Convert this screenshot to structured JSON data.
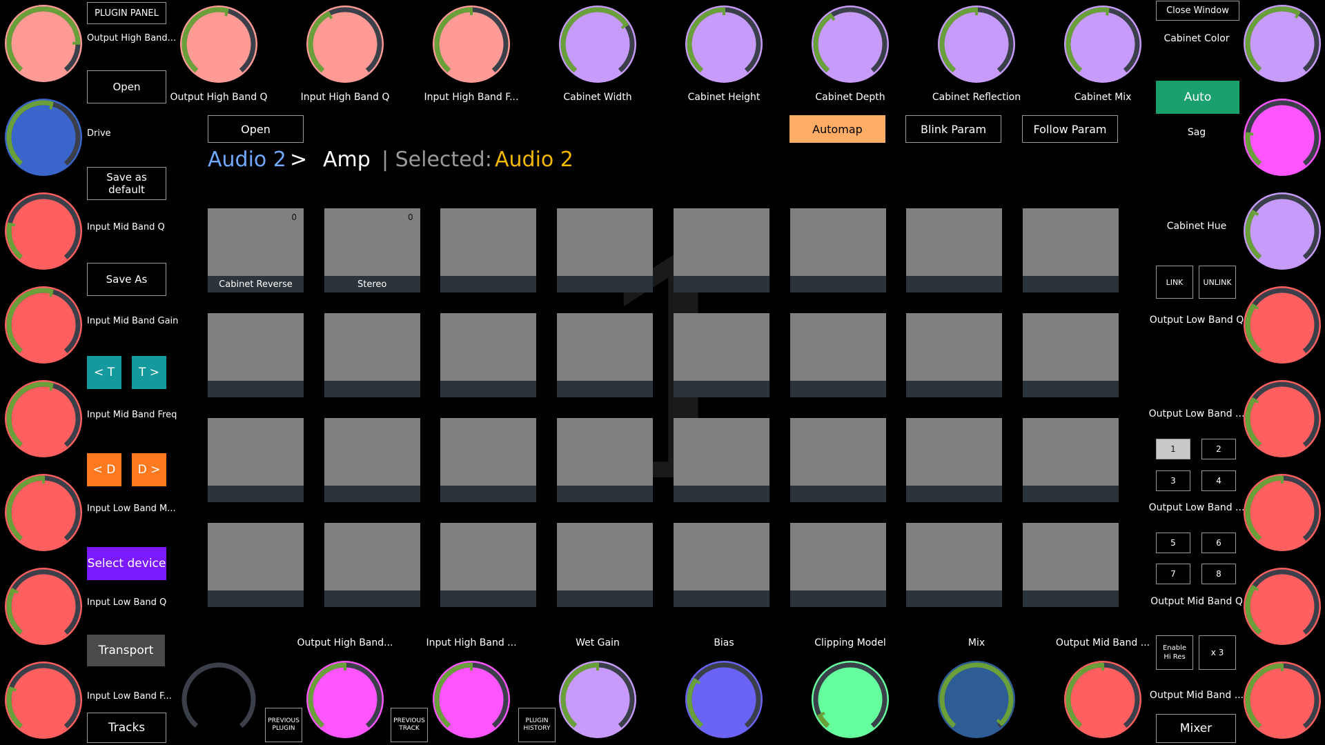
{
  "colors": {
    "arc_bg": "#3a3f4a",
    "arc_value": "#6aa03a",
    "pink": "#ff9a95",
    "red": "#ff5f5f",
    "purple": "#c79bfa",
    "blue": "#3a66cc",
    "magenta": "#ff55ff",
    "periwinkle": "#6b63f5",
    "mint": "#66ff9e",
    "steel": "#2e5d96",
    "accent_auto": "#1aa06d",
    "accent_automap": "#ffad66",
    "teal_btn": "#14999c",
    "orange_btn": "#ff7a1e",
    "violet_btn": "#7b1aff",
    "crumb_blue": "#6fa8ff",
    "crumb_gold": "#f5b800"
  },
  "left_knobs": [
    {
      "name": "Output High Band...",
      "color": "pink",
      "value": 0.82
    },
    {
      "name": "Drive",
      "color": "blue",
      "value": 0.55
    },
    {
      "name": "Input Mid Band Q",
      "color": "red",
      "value": 0.22
    },
    {
      "name": "Input Mid Band Gain",
      "color": "red",
      "value": 0.55
    },
    {
      "name": "Input Mid Band Freq",
      "color": "red",
      "value": 0.55
    },
    {
      "name": "Input Low Band M...",
      "color": "red",
      "value": 0.5
    },
    {
      "name": "Input Low Band Q",
      "color": "red",
      "value": 0.28
    },
    {
      "name": "Input Low Band F...",
      "color": "red",
      "value": 0.25
    }
  ],
  "left_buttons": {
    "plugin_panel": "PLUGIN PANEL",
    "open": "Open",
    "save_default": "Save as default",
    "save_as": "Save As",
    "prev_track": "< T",
    "next_track": "T >",
    "prev_device": "< D",
    "next_device": "D >",
    "select_device": "Select device",
    "transport": "Transport",
    "tracks": "Tracks"
  },
  "top_knobs": [
    {
      "name": "Output High Band Q",
      "color": "pink",
      "value": 0.55
    },
    {
      "name": "Input High Band Q",
      "color": "pink",
      "value": 0.4
    },
    {
      "name": "Input High Band F...",
      "color": "pink",
      "value": 0.5
    },
    {
      "name": "Cabinet Width",
      "color": "purple",
      "value": 0.7
    },
    {
      "name": "Cabinet Height",
      "color": "purple",
      "value": 0.5
    },
    {
      "name": "Cabinet Depth",
      "color": "purple",
      "value": 0.38
    },
    {
      "name": "Cabinet Reflection",
      "color": "purple",
      "value": 0.5
    },
    {
      "name": "Cabinet Mix",
      "color": "purple",
      "value": 0.53
    }
  ],
  "header": {
    "open": "Open",
    "automap": "Automap",
    "blink": "Blink Param",
    "follow": "Follow Param"
  },
  "breadcrumb": {
    "track": "Audio 2",
    "sep": ">",
    "device": "Amp",
    "selected_label": "| Selected:",
    "selected_value": "Audio 2"
  },
  "page_number": "1",
  "pads": [
    {
      "label": "Cabinet Reverse",
      "value": "0"
    },
    {
      "label": "Stereo",
      "value": "0"
    },
    {
      "label": "",
      "value": ""
    },
    {
      "label": "",
      "value": ""
    },
    {
      "label": "",
      "value": ""
    },
    {
      "label": "",
      "value": ""
    },
    {
      "label": "",
      "value": ""
    },
    {
      "label": "",
      "value": ""
    },
    {
      "label": "",
      "value": ""
    },
    {
      "label": "",
      "value": ""
    },
    {
      "label": "",
      "value": ""
    },
    {
      "label": "",
      "value": ""
    },
    {
      "label": "",
      "value": ""
    },
    {
      "label": "",
      "value": ""
    },
    {
      "label": "",
      "value": ""
    },
    {
      "label": "",
      "value": ""
    },
    {
      "label": "",
      "value": ""
    },
    {
      "label": "",
      "value": ""
    },
    {
      "label": "",
      "value": ""
    },
    {
      "label": "",
      "value": ""
    },
    {
      "label": "",
      "value": ""
    },
    {
      "label": "",
      "value": ""
    },
    {
      "label": "",
      "value": ""
    },
    {
      "label": "",
      "value": ""
    },
    {
      "label": "",
      "value": ""
    },
    {
      "label": "",
      "value": ""
    },
    {
      "label": "",
      "value": ""
    },
    {
      "label": "",
      "value": ""
    },
    {
      "label": "",
      "value": ""
    },
    {
      "label": "",
      "value": ""
    },
    {
      "label": "",
      "value": ""
    },
    {
      "label": "",
      "value": ""
    }
  ],
  "bottom_knobs": [
    {
      "name": "",
      "color": "none",
      "value": 0
    },
    {
      "name": "Output High Band...",
      "color": "magenta",
      "value": 0.5
    },
    {
      "name": "Input High Band ...",
      "color": "magenta",
      "value": 0.5
    },
    {
      "name": "Wet Gain",
      "color": "purple",
      "value": 0.5
    },
    {
      "name": "Bias",
      "color": "periwinkle",
      "value": 0.3
    },
    {
      "name": "Clipping Model",
      "color": "mint",
      "value": 0.08
    },
    {
      "name": "Mix",
      "color": "steel",
      "value": 0.98
    },
    {
      "name": "Output Mid Band ...",
      "color": "red",
      "value": 0.5
    }
  ],
  "bottom_small": {
    "prev_plugin": [
      "PREVIOUS",
      "PLUGIN"
    ],
    "prev_track": [
      "PREVIOUS",
      "TRACK"
    ],
    "plugin_history": [
      "PLUGIN",
      "HISTORY"
    ]
  },
  "right_knobs": [
    {
      "name": "Cabinet Color",
      "color": "purple",
      "value": 0.6
    },
    {
      "name": "Sag",
      "color": "magenta",
      "value": 0.2
    },
    {
      "name": "Cabinet Hue",
      "color": "purple",
      "value": 0.3
    },
    {
      "name": "Output Low Band Q",
      "color": "red",
      "value": 0.3
    },
    {
      "name": "Output Low Band ...",
      "color": "red",
      "value": 0.3
    },
    {
      "name": "Output Low Band ...",
      "color": "red",
      "value": 0.5
    },
    {
      "name": "Output Mid Band Q",
      "color": "red",
      "value": 0.3
    },
    {
      "name": "Output Mid Band ...",
      "color": "red",
      "value": 0.5
    }
  ],
  "right_buttons": {
    "close_window": "Close Window",
    "auto": "Auto",
    "link": "LINK",
    "unlink": "UNLINK",
    "pages": [
      "1",
      "2",
      "3",
      "4",
      "5",
      "6",
      "7",
      "8"
    ],
    "enable_hires": [
      "Enable",
      "Hi Res"
    ],
    "x3": "x 3",
    "mixer": "Mixer"
  }
}
